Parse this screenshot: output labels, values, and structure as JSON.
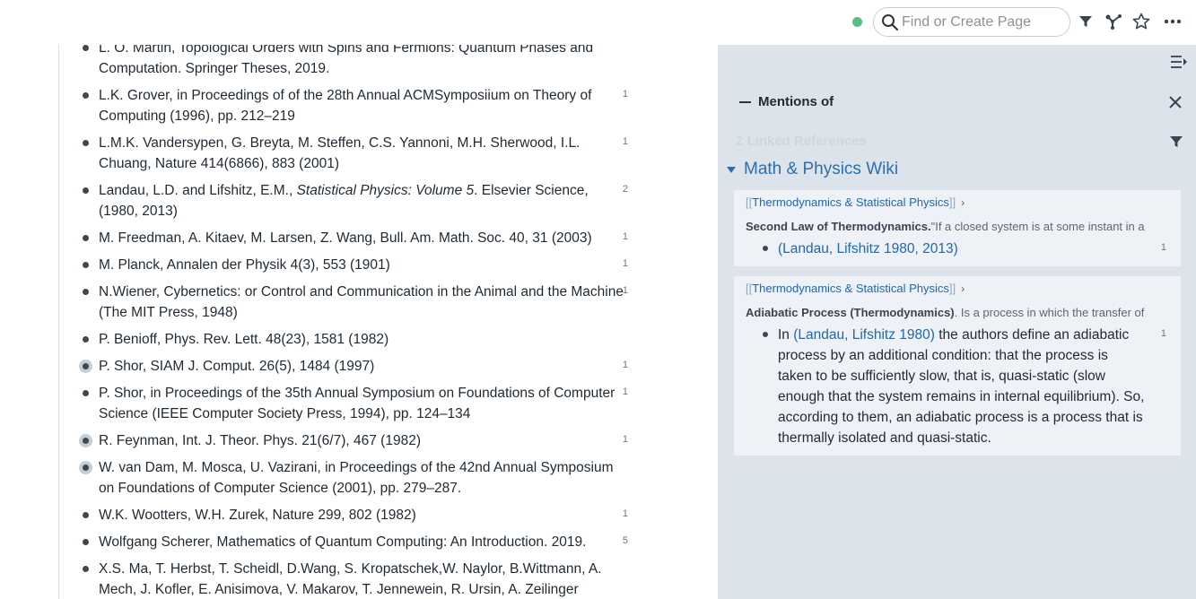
{
  "topbar": {
    "search_placeholder": "Find or Create Page",
    "icons": [
      "search-icon",
      "filter-icon",
      "graph-icon",
      "star-icon",
      "more-icon"
    ]
  },
  "references": [
    {
      "text": "L. O. Martin, Topological Orders with Spins and Fermions: Quantum Phases and Computation. Springer Theses, 2019.",
      "count": "",
      "halo": false
    },
    {
      "text": "L.K. Grover, in Proceedings of of the 28th Annual ACMSymposiium on Theory of Computing (1996), pp. 212–219",
      "count": "1",
      "halo": false
    },
    {
      "text": "L.M.K. Vandersypen, G. Breyta, M. Steffen, C.S. Yannoni, M.H. Sherwood, I.L. Chuang, Nature 414(6866), 883 (2001)",
      "count": "1",
      "halo": false
    },
    {
      "pre": "Landau, L.D. and Lifshitz, E.M., ",
      "italic": "Statistical Physics: Volume 5",
      "post": ". Elsevier Science, (1980, 2013)",
      "count": "2",
      "halo": false
    },
    {
      "text": "M. Freedman, A. Kitaev, M. Larsen, Z. Wang, Bull. Am. Math. Soc. 40, 31 (2003)",
      "count": "1",
      "halo": false
    },
    {
      "text": "M. Planck, Annalen der Physik 4(3), 553 (1901)",
      "count": "1",
      "halo": false
    },
    {
      "text": "N.Wiener, Cybernetics: or Control and Communication in the Animal and the Machine (The MIT Press, 1948)",
      "count": "1",
      "halo": false
    },
    {
      "text": "P. Benioff, Phys. Rev. Lett. 48(23), 1581 (1982)",
      "count": "",
      "halo": false
    },
    {
      "text": "P. Shor, SIAM J. Comput. 26(5), 1484 (1997)",
      "count": "1",
      "halo": true
    },
    {
      "text": "P. Shor, in Proceedings of the 35th Annual Symposium on Foundations of Computer Science (IEEE Computer Society Press, 1994), pp. 124–134",
      "count": "1",
      "halo": false
    },
    {
      "text": "R. Feynman, Int. J. Theor. Phys. 21(6/7), 467 (1982)",
      "count": "1",
      "halo": true
    },
    {
      "text": "W. van Dam, M. Mosca, U. Vazirani, in Proceedings of the 42nd Annual Symposium on Foundations of Computer Science (2001), pp. 279–287.",
      "count": "",
      "halo": true
    },
    {
      "text": "W.K. Wootters, W.H. Zurek, Nature 299, 802 (1982)",
      "count": "1",
      "halo": false
    },
    {
      "text": "Wolfgang Scherer, Mathematics of Quantum Computing: An Introduction. 2019.",
      "count": "5",
      "halo": false
    },
    {
      "text": "X.S. Ma, T. Herbst, T. Scheidl, D.Wang, S. Kropatschek,W. Naylor, B.Wittmann, A. Mech, J. Kofler, E. Anisimova, V. Makarov, T. Jennewein, R. Ursin, A. Zeilinger",
      "count": "",
      "halo": false
    }
  ],
  "sidebar": {
    "mentions_title": "Mentions of",
    "linked_refs": "2 Linked References",
    "page_name": "Math & Physics Wiki",
    "cards": [
      {
        "crumb_open": "[[",
        "crumb_link": "Thermodynamics & Statistical Physics",
        "crumb_close": "]]",
        "ctx_bold": "Second Law of Thermodynamics.",
        "ctx_rest": "\"If a closed system is at some instant in a",
        "body_pre": "",
        "body_link": "(Landau, Lifshitz 1980, 2013)",
        "body_post": "",
        "count": "1"
      },
      {
        "crumb_open": "[[",
        "crumb_link": "Thermodynamics & Statistical Physics",
        "crumb_close": "]]",
        "ctx_bold": "Adiabatic Process (Thermodynamics)",
        "ctx_rest": ". Is a process in which the transfer of",
        "body_pre": "In ",
        "body_link": "(Landau, Lifshitz 1980)",
        "body_post": " the authors define an adiabatic process by an additional condition: that the process is taken to be sufficiently slow, that is, quasi-static (slow enough that the system remains in internal equilibrium). So, according to them, an adiabatic process is a process that is thermally isolated and quasi-static.",
        "count": "1"
      }
    ]
  },
  "colors": {
    "link": "#1f66b3",
    "page_link": "#2a6fb0",
    "sidebar_bg": "#dde3ea",
    "card_bg": "#eef2f6",
    "sync_dot": "#3cb371"
  }
}
